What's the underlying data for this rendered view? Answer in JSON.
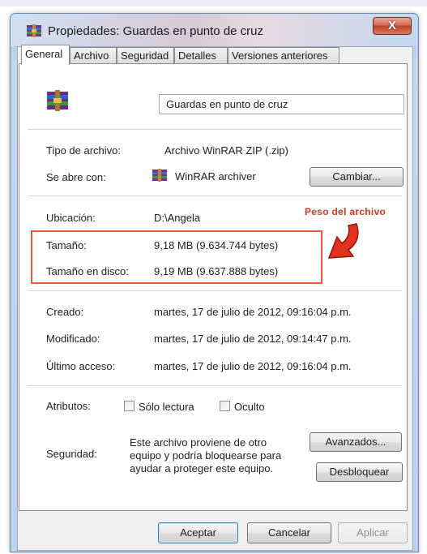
{
  "window": {
    "title": "Propiedades: Guardas en punto de cruz",
    "close_label": "X"
  },
  "tabs": [
    {
      "label": "General",
      "active": true
    },
    {
      "label": "Archivo"
    },
    {
      "label": "Seguridad"
    },
    {
      "label": "Detalles"
    },
    {
      "label": "Versiones anteriores"
    }
  ],
  "general": {
    "file_name": "Guardas en punto de cruz",
    "file_icon": "winrar-archive-icon",
    "type_label": "Tipo de archivo:",
    "type_value": "Archivo WinRAR ZIP (.zip)",
    "opens_with_label": "Se abre con:",
    "opens_with_value": "WinRAR archiver",
    "change_button": "Cambiar...",
    "location_label": "Ubicación:",
    "location_value": "D:\\Angela",
    "size_label": "Tamaño:",
    "size_value": "9,18 MB (9.634.744 bytes)",
    "disk_size_label": "Tamaño en disco:",
    "disk_size_value": "9,19 MB (9.637.888 bytes)",
    "created_label": "Creado:",
    "created_value": "martes, 17 de julio de 2012, 09:16:04 p.m.",
    "modified_label": "Modificado:",
    "modified_value": "martes, 17 de julio de 2012, 09:14:47 p.m.",
    "accessed_label": "Último acceso:",
    "accessed_value": "martes, 17 de julio de 2012, 09:16:04 p.m.",
    "attributes_label": "Atributos:",
    "readonly_label": "Sólo lectura",
    "readonly_checked": false,
    "hidden_label": "Oculto",
    "hidden_checked": false,
    "advanced_button": "Avanzados...",
    "security_label": "Seguridad:",
    "security_text_1": "Este archivo proviene de otro",
    "security_text_2": "equipo y podría bloquearse para",
    "security_text_3": "ayudar a proteger este equipo.",
    "unblock_button": "Desbloquear"
  },
  "annotation": {
    "text": "Peso del archivo",
    "color": "#e0341f"
  },
  "footer": {
    "ok_button": "Aceptar",
    "cancel_button": "Cancelar",
    "apply_button": "Aplicar"
  }
}
